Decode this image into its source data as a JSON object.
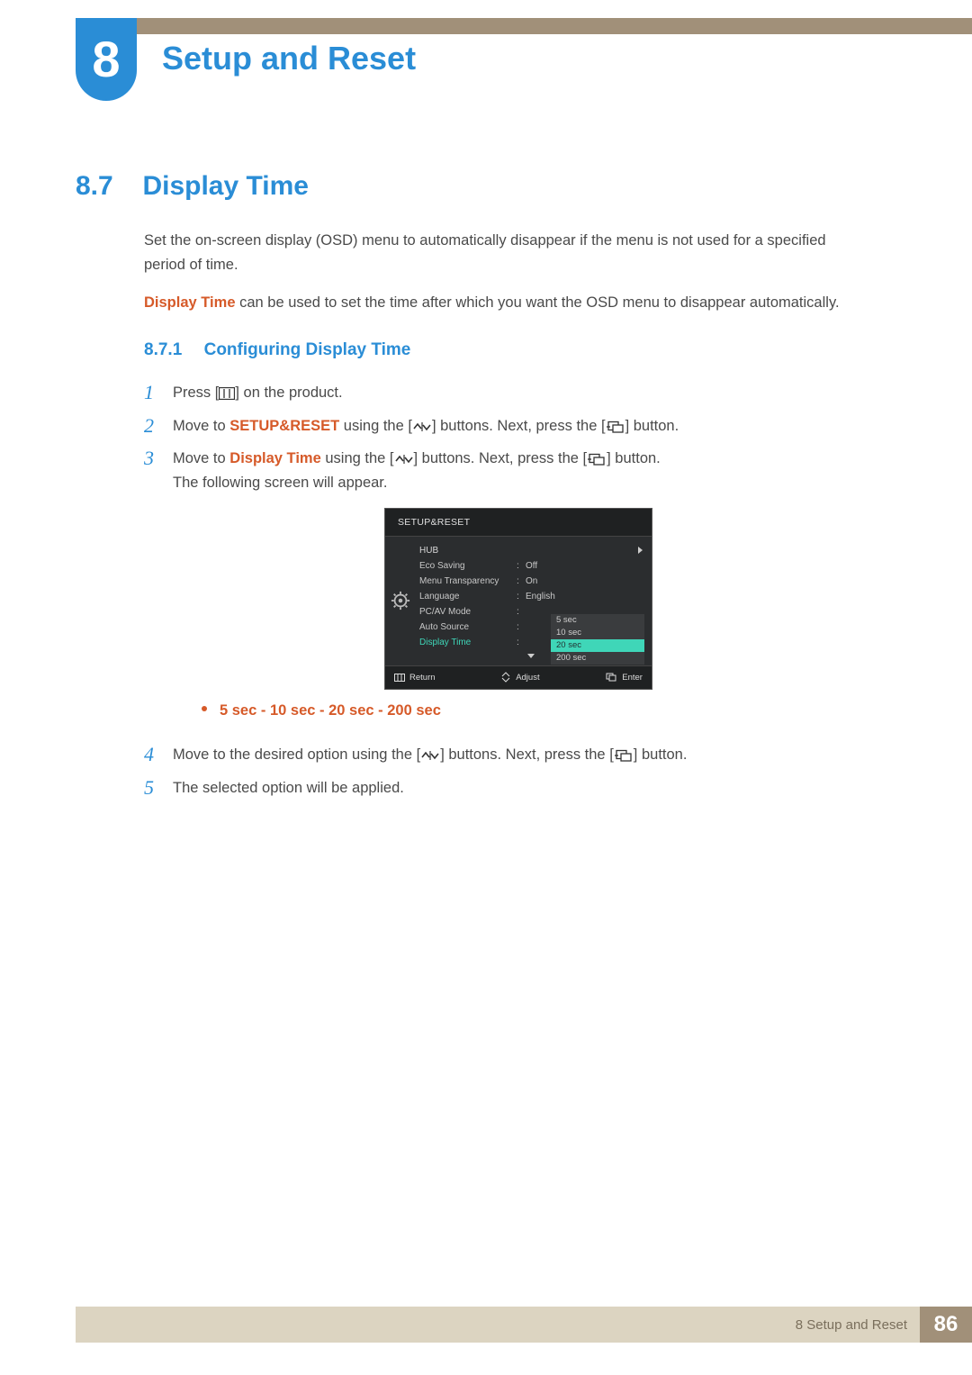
{
  "chapter": {
    "number": "8",
    "title": "Setup and Reset"
  },
  "section": {
    "number": "8.7",
    "title": "Display Time"
  },
  "intro": {
    "p1": "Set the on-screen display (OSD) menu to automatically disappear if the menu is not used for a specified period of time.",
    "term": "Display Time",
    "p2_rest": " can be used to set the time after which you want the OSD menu to disappear automatically."
  },
  "subsection": {
    "number": "8.7.1",
    "title": "Configuring Display Time"
  },
  "steps": {
    "s1": {
      "n": "1",
      "a": "Press [",
      "b": "] on the product."
    },
    "s2": {
      "n": "2",
      "a": "Move to ",
      "kw": "SETUP&RESET",
      "b": " using the [",
      "c": "] buttons. Next, press the [",
      "d": "] button."
    },
    "s3": {
      "n": "3",
      "a": "Move to ",
      "kw": "Display Time",
      "b": " using the [",
      "c": "] buttons. Next, press the [",
      "d": "] button.",
      "e": "The following screen will appear."
    },
    "s4": {
      "n": "4",
      "a": "Move to the desired option using the [",
      "b": "] buttons. Next, press the [",
      "c": "] button."
    },
    "s5": {
      "n": "5",
      "a": "The selected option will be applied."
    }
  },
  "bullet": {
    "o1": "5 sec",
    "o2": "10 sec",
    "o3": "20 sec",
    "o4": "200 sec",
    "sep": " - "
  },
  "osd": {
    "title": "SETUP&RESET",
    "rows": {
      "hub": "HUB",
      "eco": "Eco Saving",
      "eco_v": "Off",
      "menu": "Menu Transparency",
      "menu_v": "On",
      "lang": "Language",
      "lang_v": "English",
      "pcav": "PC/AV Mode",
      "auto": "Auto Source",
      "disp": "Display Time"
    },
    "popup": {
      "a": "5 sec",
      "b": "10 sec",
      "c": "20 sec",
      "d": "200 sec"
    },
    "footer": {
      "ret": "Return",
      "adj": "Adjust",
      "ent": "Enter"
    }
  },
  "footer": {
    "label": "8 Setup and Reset",
    "page": "86"
  }
}
